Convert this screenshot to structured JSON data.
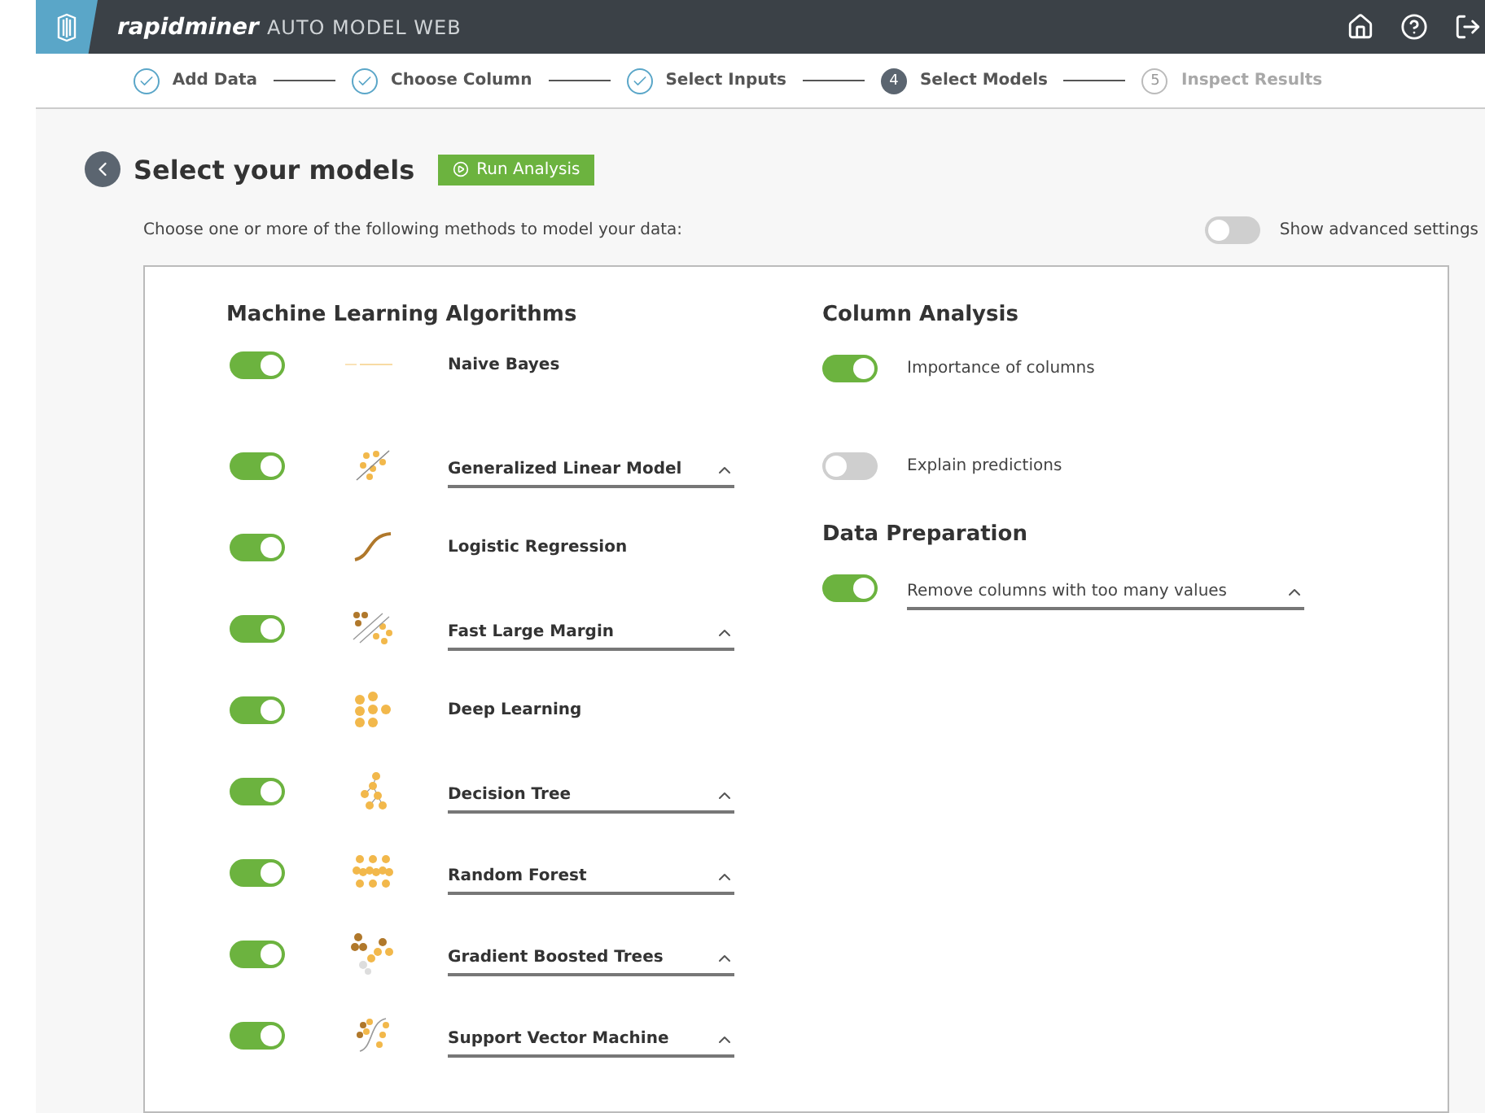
{
  "header": {
    "brand": "rapidminer",
    "product": "AUTO MODEL WEB"
  },
  "steps": [
    {
      "label": "Add Data",
      "completed": true,
      "selected": false
    },
    {
      "label": "Choose Column",
      "completed": true,
      "selected": false
    },
    {
      "label": "Select Inputs",
      "completed": true,
      "selected": false
    },
    {
      "label": "Select Models",
      "number": "4",
      "completed": false,
      "selected": true
    },
    {
      "label": "Inspect Results",
      "number": "5",
      "completed": false,
      "selected": false
    }
  ],
  "title": "Select your models",
  "run_button": "Run Analysis",
  "description": "Choose one or more of the following methods to model your data:",
  "advanced": {
    "label": "Show advanced settings",
    "on": false
  },
  "algorithms": {
    "heading": "Machine Learning Algorithms",
    "items": [
      {
        "name": "Naive Bayes",
        "on": true,
        "expandable": false
      },
      {
        "name": "Generalized Linear Model",
        "on": true,
        "expandable": true
      },
      {
        "name": "Logistic Regression",
        "on": true,
        "expandable": false
      },
      {
        "name": "Fast Large Margin",
        "on": true,
        "expandable": true
      },
      {
        "name": "Deep Learning",
        "on": true,
        "expandable": false
      },
      {
        "name": "Decision Tree",
        "on": true,
        "expandable": true
      },
      {
        "name": "Random Forest",
        "on": true,
        "expandable": true
      },
      {
        "name": "Gradient Boosted Trees",
        "on": true,
        "expandable": true
      },
      {
        "name": "Support Vector Machine",
        "on": true,
        "expandable": true
      }
    ]
  },
  "column_analysis": {
    "heading": "Column Analysis",
    "items": [
      {
        "name": "Importance of columns",
        "on": true,
        "expandable": false
      },
      {
        "name": "Explain predictions",
        "on": false,
        "expandable": false
      }
    ]
  },
  "data_preparation": {
    "heading": "Data Preparation",
    "items": [
      {
        "name": "Remove columns with too many values",
        "on": true,
        "expandable": true
      }
    ]
  }
}
